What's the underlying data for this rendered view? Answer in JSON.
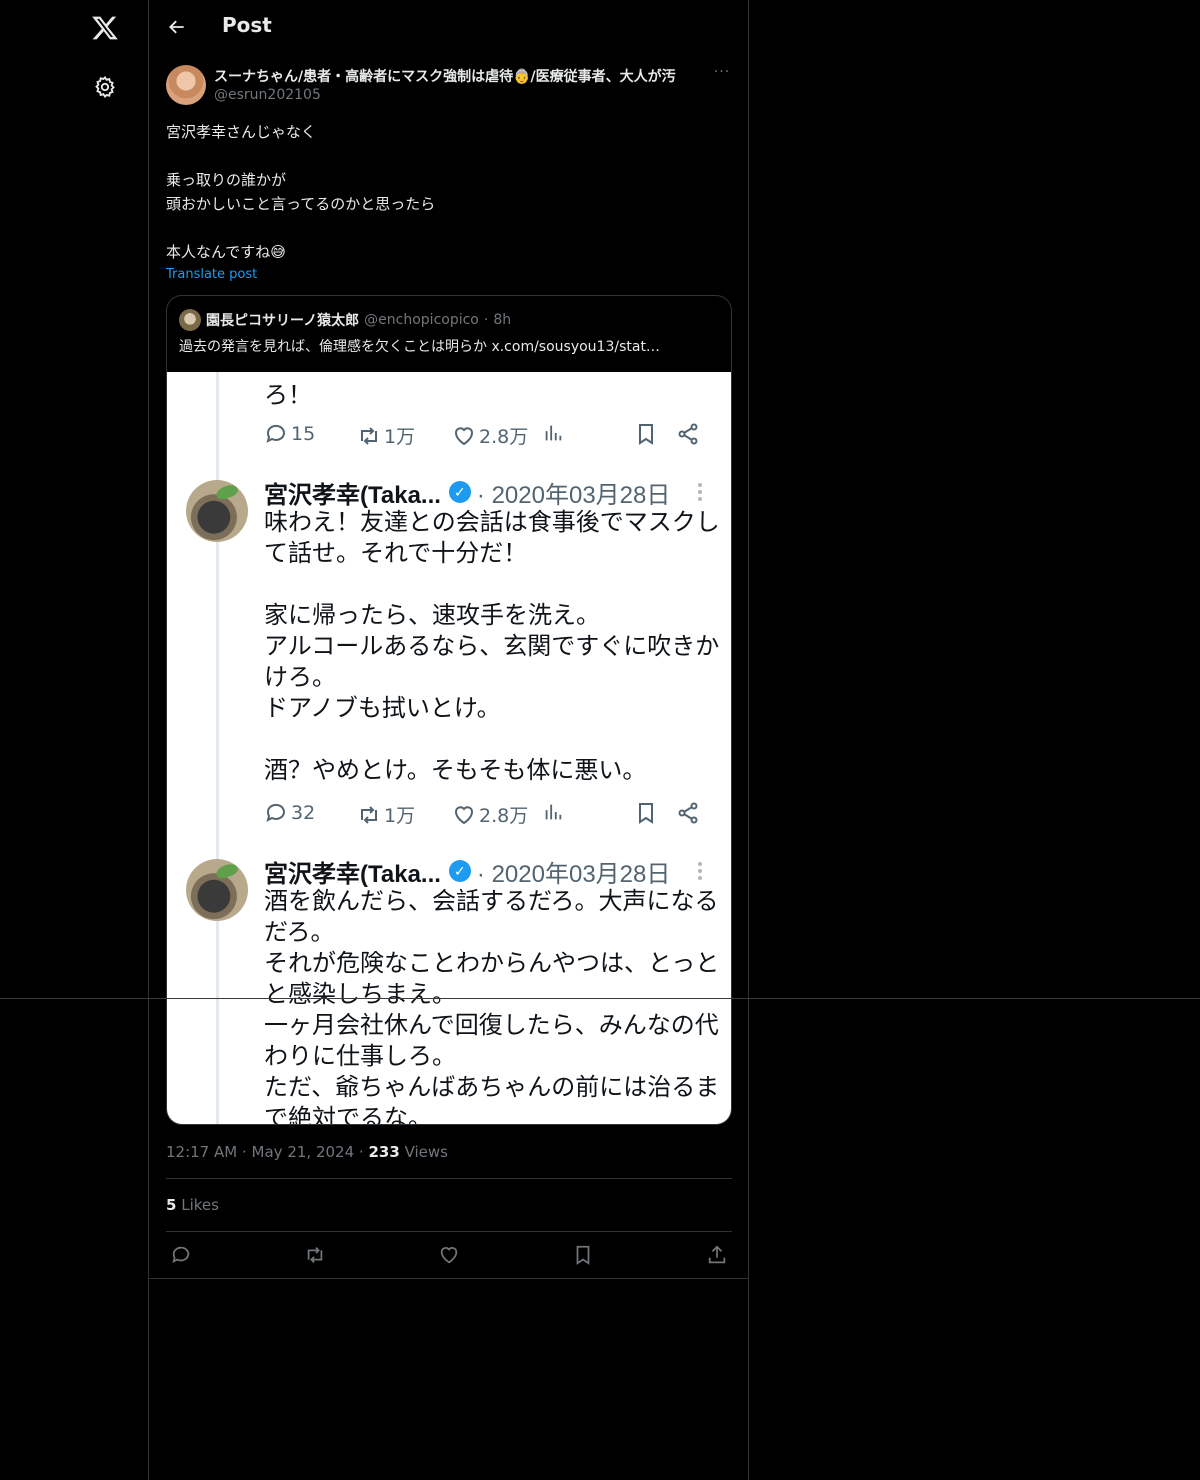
{
  "header": {
    "title": "Post"
  },
  "post": {
    "display_name": "スーナちゃん/患者・高齢者にマスク強制は虐待👵/医療従事者、大人が汚",
    "handle": "@esrun202105",
    "text": "宮沢孝幸さんじゃなく\n\n乗っ取りの誰かが\n頭おかしいこと言ってるのかと思ったら\n\n本人なんですね😅",
    "translate_label": "Translate post",
    "more_label": "···"
  },
  "quote": {
    "display_name": "園長ピコサリーノ猿太郎",
    "handle": "@enchopicopico",
    "separator": "·",
    "time": "8h",
    "text": "過去の発言を見れば、倫理感を欠くことは明らか  x.com/sousyou13/stat…",
    "image": {
      "top_text": "ろ！",
      "tweets": [
        {
          "author": "宮沢孝幸(Taka...",
          "date": "· 2020年03月28日",
          "body": "味わえ！友達との会話は食事後でマスクし\nて話せ。それで十分だ！\n\n家に帰ったら、速攻手を洗え。\nアルコールあるなら、玄関ですぐに吹きか\nけろ。\nドアノブも拭いとけ。\n\n酒？やめとけ。そもそも体に悪い。"
        },
        {
          "author": "宮沢孝幸(Taka...",
          "date": "· 2020年03月28日",
          "body": "酒を飲んだら、会話するだろ。大声になる\nだろ。\nそれが危険なことわからんやつは、とっと\nと感染しちまえ。\n一ヶ月会社休んで回復したら、みんなの代\nわりに仕事しろ。\nただ、爺ちゃんばあちゃんの前には治るま\nで絶対でるな。"
        }
      ],
      "stats_rows": [
        {
          "replies": "15",
          "reposts": "1万",
          "likes": "2.8万"
        },
        {
          "replies": "32",
          "reposts": "1万",
          "likes": "2.8万"
        }
      ]
    }
  },
  "meta": {
    "time": "12:17 AM",
    "dot1": "·",
    "date": "May 21, 2024",
    "dot2": "·",
    "views_count": "233",
    "views_label": "Views"
  },
  "likes": {
    "count": "5",
    "label": "Likes"
  },
  "icons": {
    "nav": [
      "x-logo-icon",
      "gear-icon"
    ],
    "header": [
      "back-arrow-icon"
    ],
    "actions": [
      "reply-icon",
      "repost-icon",
      "like-icon",
      "bookmark-icon",
      "share-icon"
    ]
  },
  "colors": {
    "background": "#000000",
    "text": "#e7e9ea",
    "muted": "#71767b",
    "accent": "#1d9bf0",
    "border": "#2f3336"
  }
}
